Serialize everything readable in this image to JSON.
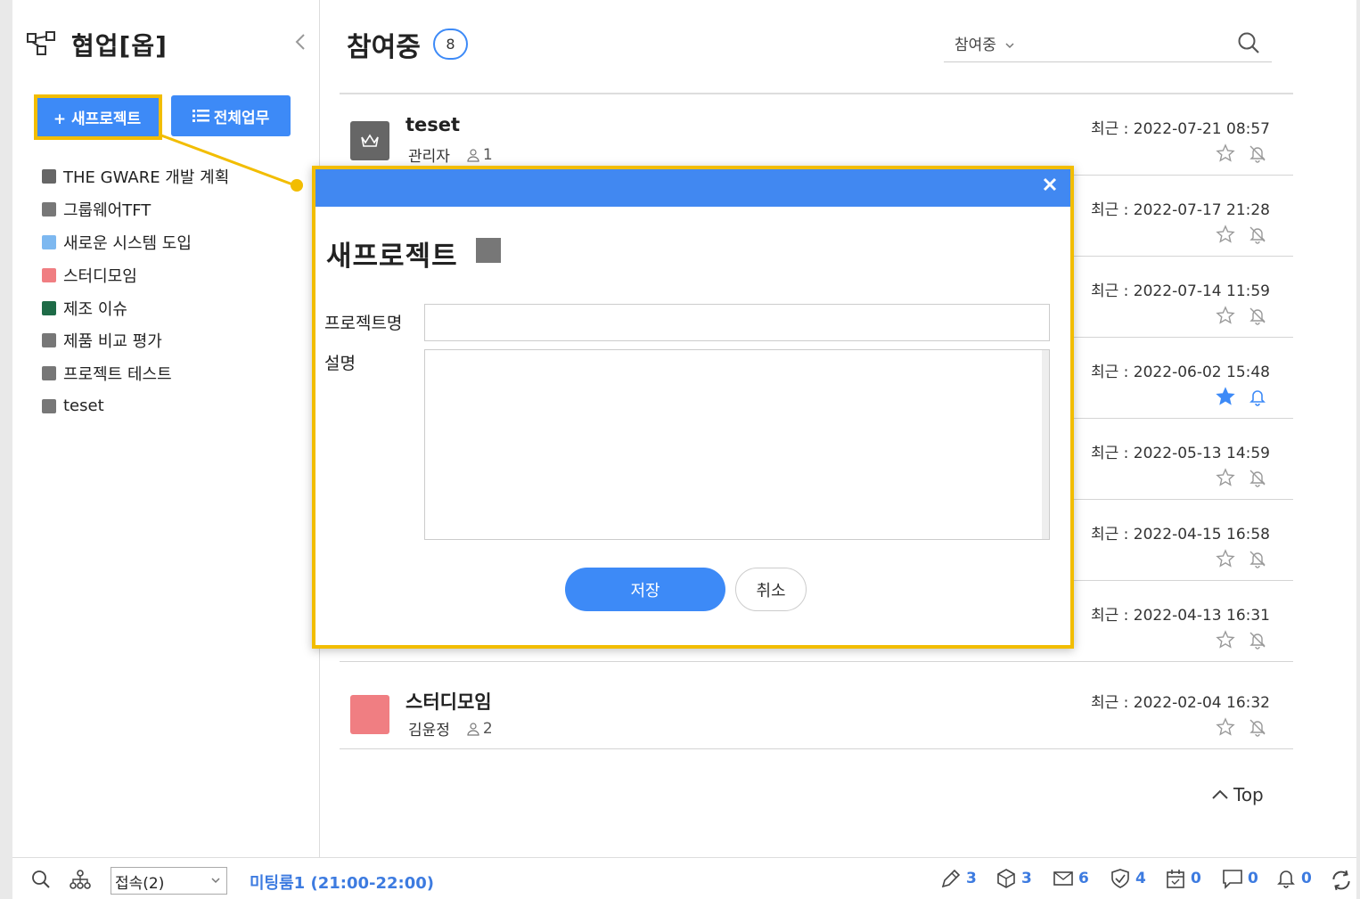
{
  "sidebar": {
    "title": "협업[옵]",
    "new_project_label": "+ 새프로젝트",
    "all_tasks_label": "전체업무",
    "projects": [
      {
        "label": "THE GWARE 개발 계획",
        "color": "#666666"
      },
      {
        "label": "그룹웨어TFT",
        "color": "#777777"
      },
      {
        "label": "새로운 시스템 도입",
        "color": "#7db8f0"
      },
      {
        "label": "스터디모임",
        "color": "#f07e82"
      },
      {
        "label": "제조 이슈",
        "color": "#1e6b47"
      },
      {
        "label": "제품 비교 평가",
        "color": "#777777"
      },
      {
        "label": "프로젝트 테스트",
        "color": "#777777"
      },
      {
        "label": "teset",
        "color": "#777777"
      }
    ]
  },
  "main": {
    "title": "참여중",
    "count": "8",
    "filter_value": "참여중",
    "rows": [
      {
        "name": "teset",
        "owner": "관리자",
        "members": "1",
        "date": "최근 : 2022-07-21 08:57",
        "starred": false,
        "bell_on": false,
        "icon_color": "#666666"
      },
      {
        "name": "",
        "owner": "",
        "members": "",
        "date": "최근 : 2022-07-17 21:28",
        "starred": false,
        "bell_on": false,
        "icon_color": "#777777"
      },
      {
        "name": "",
        "owner": "",
        "members": "",
        "date": "최근 : 2022-07-14 11:59",
        "starred": false,
        "bell_on": false,
        "icon_color": "#777777"
      },
      {
        "name": "",
        "owner": "",
        "members": "",
        "date": "최근 : 2022-06-02 15:48",
        "starred": true,
        "bell_on": true,
        "icon_color": "#777777"
      },
      {
        "name": "",
        "owner": "",
        "members": "",
        "date": "최근 : 2022-05-13 14:59",
        "starred": false,
        "bell_on": false,
        "icon_color": "#777777"
      },
      {
        "name": "",
        "owner": "",
        "members": "",
        "date": "최근 : 2022-04-15 16:58",
        "starred": false,
        "bell_on": false,
        "icon_color": "#777777"
      },
      {
        "name": "",
        "owner": "",
        "members": "",
        "date": "최근 : 2022-04-13 16:31",
        "starred": false,
        "bell_on": false,
        "icon_color": "#777777"
      },
      {
        "name": "스터디모임",
        "owner": "김윤정",
        "members": "2",
        "date": "최근 : 2022-02-04 16:32",
        "starred": false,
        "bell_on": false,
        "icon_color": "#f07e82"
      }
    ],
    "top_label": "Top"
  },
  "modal": {
    "title": "새프로젝트",
    "name_label": "프로젝트명",
    "desc_label": "설명",
    "name_value": "",
    "desc_value": "",
    "save_label": "저장",
    "cancel_label": "취소",
    "color_square": "#777777"
  },
  "statusbar": {
    "status_select": "접속(2)",
    "meeting": "미팅룸1 (21:00-22:00)",
    "stats": [
      {
        "icon": "pen-icon",
        "value": "3"
      },
      {
        "icon": "cube-icon",
        "value": "3"
      },
      {
        "icon": "mail-icon",
        "value": "6"
      },
      {
        "icon": "shield-check-icon",
        "value": "4"
      },
      {
        "icon": "calendar-check-icon",
        "value": "0"
      },
      {
        "icon": "chat-icon",
        "value": "0"
      },
      {
        "icon": "bell-icon",
        "value": "0"
      }
    ]
  },
  "colors": {
    "accent": "#3d8af7",
    "highlight": "#f2bd00",
    "modal_header": "#4188f1"
  }
}
